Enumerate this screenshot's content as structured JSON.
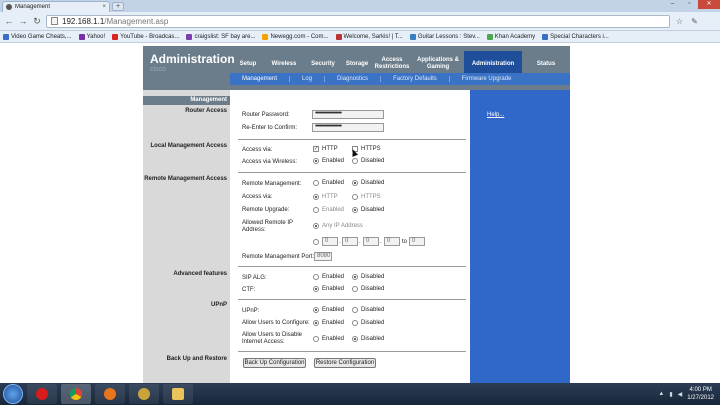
{
  "browser": {
    "tab_title": "Management",
    "tab_close": "×",
    "new_tab": "+",
    "url_host": "192.168.1.1",
    "url_path": "/Management.asp",
    "win_min": "–",
    "win_max": "▫",
    "win_close": "✕",
    "back": "←",
    "forward": "→",
    "reload": "↻",
    "star": "☆",
    "wrench": "✎"
  },
  "bookmarks": [
    {
      "label": "Video Game Cheats,...",
      "color": "#3b6ec2"
    },
    {
      "label": "Yahoo!",
      "color": "#7b2fa8"
    },
    {
      "label": "YouTube - Broadcas...",
      "color": "#d22"
    },
    {
      "label": "craigslist: SF bay are...",
      "color": "#7b3fb0"
    },
    {
      "label": "Newegg.com - Com...",
      "color": "#f2a500"
    },
    {
      "label": "Welcome, Sarkis! | T...",
      "color": "#bb3333"
    },
    {
      "label": "Guitar Lessons : Stev...",
      "color": "#3a7fc6"
    },
    {
      "label": "Khan Academy",
      "color": "#4caa4c"
    },
    {
      "label": "Special Characters i...",
      "color": "#3b6ec2"
    }
  ],
  "router": {
    "logo": "Administration",
    "logo_sub": "cisco",
    "tabs": [
      "Setup",
      "Wireless",
      "Security",
      "Storage",
      "Access Restrictions",
      "Applications & Gaming",
      "Administration",
      "Status"
    ],
    "subtabs": [
      "Management",
      "Log",
      "Diagnostics",
      "Factory Defaults",
      "Firmware Upgrade"
    ],
    "help": "Help..."
  },
  "sections": {
    "management": "Management",
    "router_access": "Router Access",
    "local_mgmt": "Local Management Access",
    "remote_mgmt": "Remote Management Access",
    "advanced": "Advanced features",
    "upnp": "UPnP",
    "backup": "Back Up and Restore"
  },
  "form": {
    "router_password_label": "Router Password:",
    "router_password_value": "••••••••••••••••••",
    "reenter_label": "Re-Enter to  Confirm:",
    "reenter_value": "••••••••••••••••••",
    "access_via_label": "Access via:",
    "http": "HTTP",
    "https": "HTTPS",
    "access_wireless_label": "Access via Wireless:",
    "enabled": "Enabled",
    "disabled": "Disabled",
    "remote_mgmt_label": "Remote  Management:",
    "remote_access_via_label": "Access via:",
    "remote_upgrade_label": "Remote Upgrade:",
    "allowed_ip_label": "Allowed Remote IP Address:",
    "any_ip": "Any IP Address",
    "ip1": "0",
    "ip2": "0",
    "ip3": "0",
    "ip4": "0",
    "ip_to": "to",
    "ip5": "0",
    "dot": ".",
    "remote_port_label": "Remote Management Port:",
    "remote_port_value": "8080",
    "sip_alg_label": "SIP ALG:",
    "ctf_label": "CTF:",
    "upnp_label": "UPnP:",
    "allow_config_label": "Allow Users to Configure:",
    "allow_disable_label": "Allow Users to Disable Internet Access:",
    "backup_btn": "Back Up Configuration",
    "restore_btn": "Restore Configuration"
  },
  "taskbar": {
    "time": "4:00 PM",
    "date": "1/27/2012",
    "apps": [
      {
        "name": "opera",
        "color": "#d81b1b"
      },
      {
        "name": "chrome",
        "color": "#e8c02c"
      },
      {
        "name": "firefox",
        "color": "#e8741c"
      },
      {
        "name": "app-4",
        "color": "#c9a23a"
      },
      {
        "name": "explorer",
        "color": "#e8c45a"
      }
    ]
  }
}
